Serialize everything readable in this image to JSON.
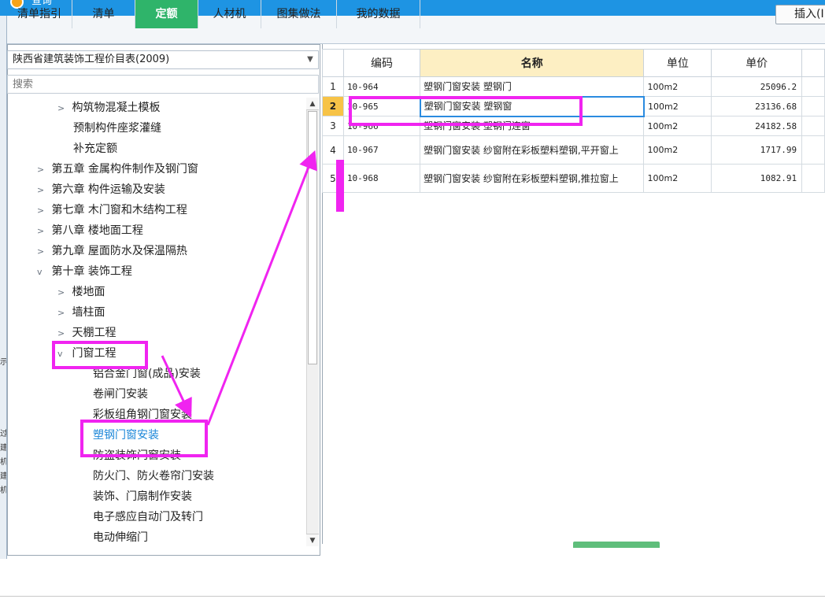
{
  "window": {
    "title": "查询"
  },
  "side_strip": [
    "示",
    "过",
    "建",
    "机",
    "建",
    "机"
  ],
  "tabs": [
    {
      "label": "清单指引",
      "active": false
    },
    {
      "label": "清单",
      "active": false
    },
    {
      "label": "定额",
      "active": true
    },
    {
      "label": "人材机",
      "active": false
    },
    {
      "label": "图集做法",
      "active": false
    },
    {
      "label": "我的数据",
      "active": false
    }
  ],
  "toolbar": {
    "insert_label": "插入(I"
  },
  "left": {
    "database": "陕西省建筑装饰工程价目表(2009)",
    "search_placeholder": "搜索",
    "tree": [
      {
        "chev": ">",
        "label": "构筑物混凝土模板"
      },
      {
        "chev": "",
        "label": "预制构件座浆灌缝"
      },
      {
        "chev": "",
        "label": "补充定额"
      },
      {
        "chev": ">",
        "label": "第五章 金属构件制作及钢门窗"
      },
      {
        "chev": ">",
        "label": "第六章 构件运输及安装"
      },
      {
        "chev": ">",
        "label": "第七章 木门窗和木结构工程"
      },
      {
        "chev": ">",
        "label": "第八章 楼地面工程"
      },
      {
        "chev": ">",
        "label": "第九章 屋面防水及保温隔热"
      },
      {
        "chev": "v",
        "label": "第十章 装饰工程"
      },
      {
        "chev": ">",
        "label": "楼地面"
      },
      {
        "chev": ">",
        "label": "墙柱面"
      },
      {
        "chev": ">",
        "label": "天棚工程"
      },
      {
        "chev": "v",
        "label": "门窗工程"
      },
      {
        "chev": "",
        "label": "铝合金门窗(成品)安装"
      },
      {
        "chev": "",
        "label": "卷闸门安装"
      },
      {
        "chev": "",
        "label": "彩板组角钢门窗安装"
      },
      {
        "chev": "",
        "label": "塑钢门窗安装"
      },
      {
        "chev": "",
        "label": "防盗装饰门窗安装"
      },
      {
        "chev": "",
        "label": "防火门、防火卷帘门安装"
      },
      {
        "chev": "",
        "label": "装饰、门扇制作安装"
      },
      {
        "chev": "",
        "label": "电子感应自动门及转门"
      },
      {
        "chev": "",
        "label": "电动伸缩门"
      }
    ]
  },
  "grid": {
    "headers": {
      "index": "",
      "code": "编码",
      "name": "名称",
      "unit": "单位",
      "price": "单价"
    },
    "rows": [
      {
        "index": "1",
        "code": "10-964",
        "name": "塑钢门窗安装 塑钢门",
        "unit": "100m2",
        "price": "25096.2"
      },
      {
        "index": "2",
        "code": "10-965",
        "name": "塑钢门窗安装 塑钢窗",
        "unit": "100m2",
        "price": "23136.68"
      },
      {
        "index": "3",
        "code": "10-966",
        "name": "塑钢门窗安装 塑钢门连窗",
        "unit": "100m2",
        "price": "24182.58"
      },
      {
        "index": "4",
        "code": "10-967",
        "name": "塑钢门窗安装 纱窗附在彩板塑料塑钢,平开窗上",
        "unit": "100m2",
        "price": "1717.99"
      },
      {
        "index": "5",
        "code": "10-968",
        "name": "塑钢门窗安装 纱窗附在彩板塑料塑钢,推拉窗上",
        "unit": "100m2",
        "price": "1082.91"
      }
    ]
  },
  "colors": {
    "accent": "#1e94e3",
    "active_tab": "#2fb46a",
    "annotation": "#f024f0"
  }
}
